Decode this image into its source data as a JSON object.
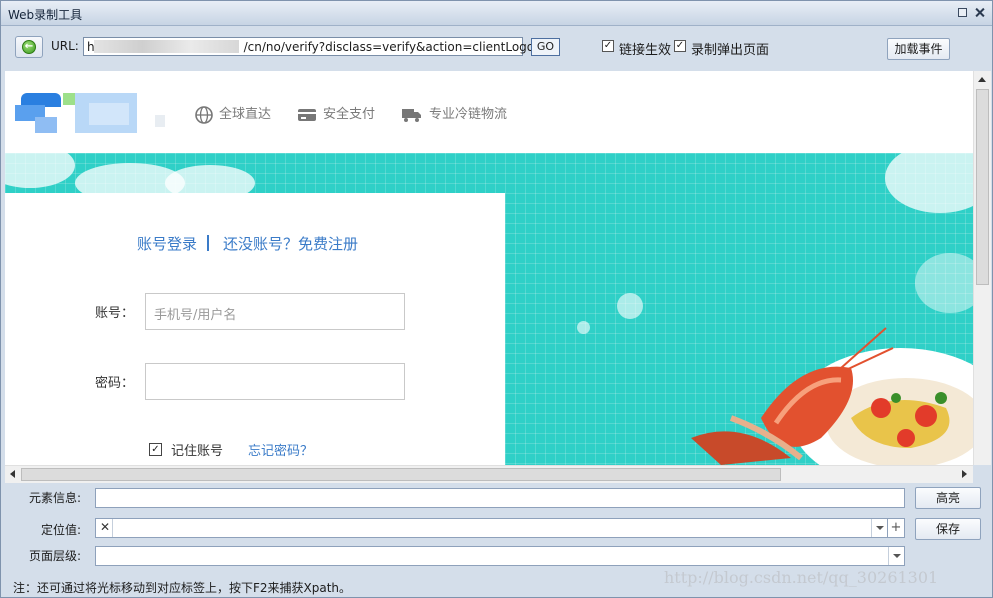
{
  "window": {
    "title": "Web录制工具"
  },
  "toolbar": {
    "url_label": "URL:",
    "url_prefix": "h",
    "url_value": "/cn/no/verify?disclass=verify&action=clientLogout",
    "go_label": "GO",
    "checkbox1_label": "链接生效",
    "checkbox1_checked": true,
    "checkbox2_label": "录制弹出页面",
    "checkbox2_checked": true,
    "add_event_label": "加载事件"
  },
  "site": {
    "nav": [
      "全球直达",
      "安全支付",
      "专业冷链物流"
    ],
    "login": {
      "tab_account": "账号登录",
      "tab_register": "还没账号？免费注册",
      "account_label": "账号：",
      "account_placeholder": "手机号/用户名",
      "password_label": "密码：",
      "password_value": "",
      "remember_label": "记住账号",
      "remember_checked": true,
      "forgot_label": "忘记密码？"
    }
  },
  "panel": {
    "element_info_label": "元素信息:",
    "element_info_value": "",
    "highlight_label": "高亮",
    "locator_label": "定位值:",
    "locator_value": "",
    "save_label": "保存",
    "page_level_label": "页面层级:",
    "page_level_value": "",
    "note": "注：还可通过将光标移动到对应标签上，按下F2来捕获Xpath。"
  },
  "watermark": "http://blog.csdn.net/qq_30261301",
  "colors": {
    "banner": "#2fd0c7",
    "link": "#3a7bc8",
    "chrome": "#d4deea"
  }
}
